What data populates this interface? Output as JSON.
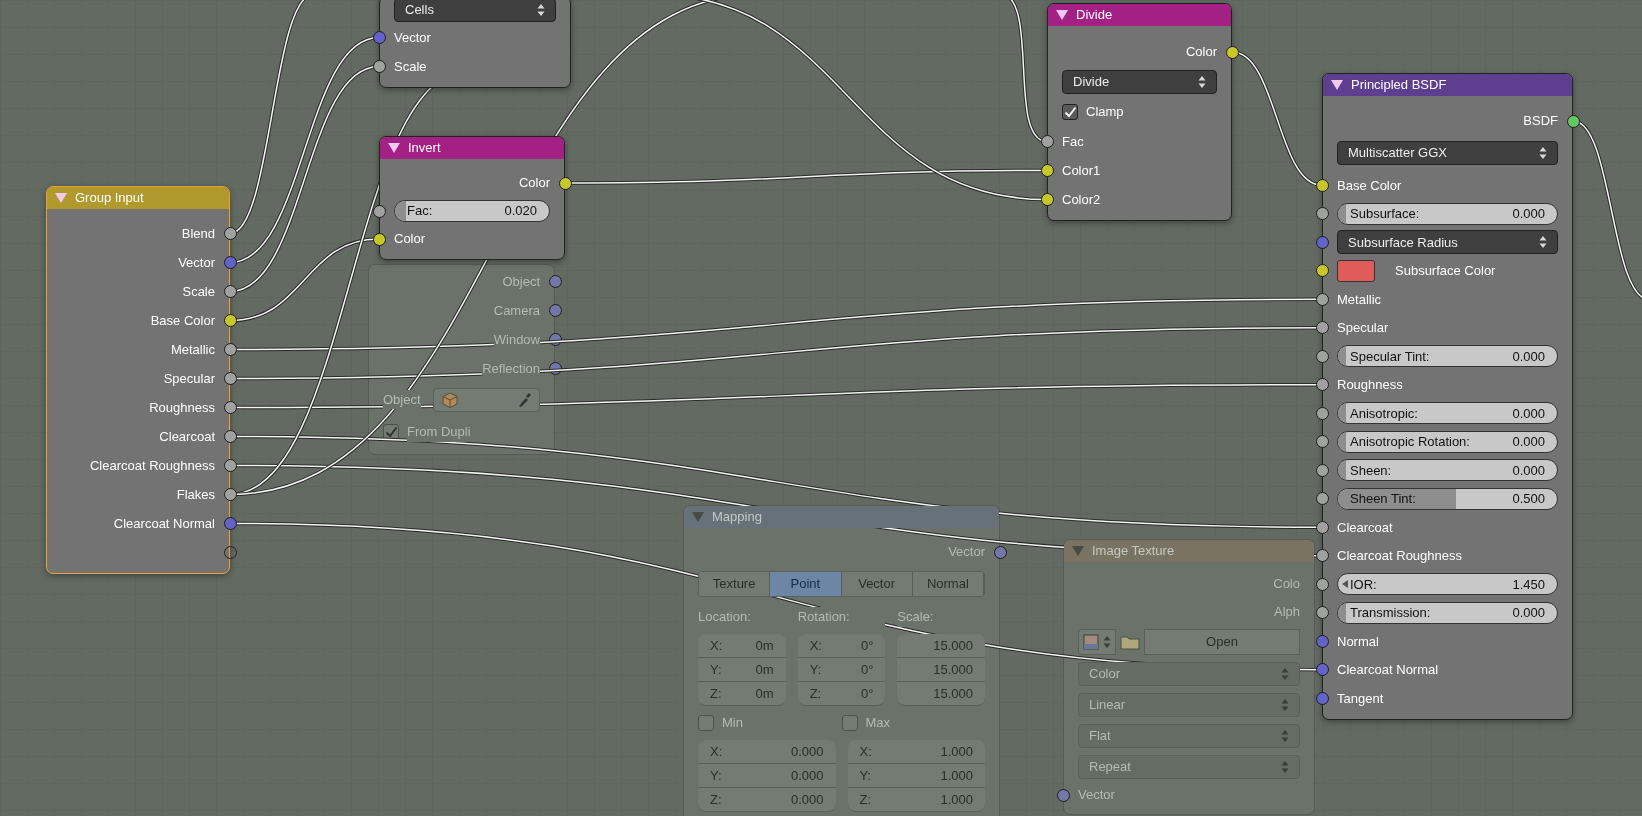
{
  "nodes": [
    {
      "kind": "group_input",
      "faded": false,
      "selected": true,
      "title": "Group Input",
      "color": "#b09a2e",
      "rows": [
        {
          "kind": "output",
          "label": "Blend",
          "color": "#a1a1a1"
        },
        {
          "kind": "output",
          "label": "Vector",
          "color": "#6363c7"
        },
        {
          "kind": "output",
          "label": "Scale",
          "color": "#a1a1a1"
        },
        {
          "kind": "output",
          "label": "Base Color",
          "color": "#c7c729"
        },
        {
          "kind": "output",
          "label": "Metallic",
          "color": "#a1a1a1"
        },
        {
          "kind": "output",
          "label": "Specular",
          "color": "#a1a1a1"
        },
        {
          "kind": "output",
          "label": "Roughness",
          "color": "#a1a1a1"
        },
        {
          "kind": "output",
          "label": "Clearcoat",
          "color": "#a1a1a1"
        },
        {
          "kind": "output",
          "label": "Clearcoat Roughness",
          "color": "#a1a1a1"
        },
        {
          "kind": "output",
          "label": "Flakes",
          "color": "#a1a1a1"
        },
        {
          "kind": "output",
          "label": "Clearcoat Normal",
          "color": "#6363c7"
        },
        {
          "kind": "blank_socket"
        }
      ]
    },
    {
      "kind": "voronoi",
      "faded": false,
      "selected": false,
      "rows": [
        {
          "kind": "dropdown",
          "label": "Cells"
        },
        {
          "kind": "input",
          "label": "Vector",
          "color": "#6363c7"
        },
        {
          "kind": "input",
          "label": "Scale",
          "color": "#a1a1a1"
        }
      ]
    },
    {
      "kind": "invert",
      "faded": false,
      "selected": false,
      "title": "Invert",
      "color": "#a32185",
      "rows": [
        {
          "kind": "output",
          "label": "Color",
          "color": "#c7c729"
        },
        {
          "kind": "slider",
          "label": "Fac:",
          "value": "0.020",
          "level": 0.02,
          "color": "#a1a1a1"
        },
        {
          "kind": "input",
          "label": "Color",
          "color": "#c7c729"
        }
      ]
    },
    {
      "kind": "texture_coordinate",
      "faded": true,
      "selected": false,
      "rows": [
        {
          "kind": "output",
          "label": "Object",
          "color": "#7277a6"
        },
        {
          "kind": "output",
          "label": "Camera",
          "color": "#7277a6"
        },
        {
          "kind": "output",
          "label": "Window",
          "color": "#7277a6"
        },
        {
          "kind": "output",
          "label": "Reflection",
          "color": "#7277a6"
        },
        {
          "kind": "object_field",
          "label": "Object"
        },
        {
          "kind": "checkbox",
          "label": "From Dupli",
          "checked": true
        }
      ]
    },
    {
      "kind": "mapping",
      "faded": true,
      "selected": false,
      "title": "Mapping",
      "color": "#66717a",
      "rows": [
        {
          "kind": "output",
          "label": "Vector",
          "color": "#7277a6"
        },
        {
          "kind": "tabs",
          "items": [
            {
              "label": "Texture",
              "selected": false
            },
            {
              "label": "Point",
              "selected": true
            },
            {
              "label": "Vector",
              "selected": false
            },
            {
              "label": "Normal",
              "selected": false
            }
          ]
        },
        {
          "kind": "headings",
          "labels": [
            "Location:",
            "Rotation:",
            "Scale:"
          ]
        },
        {
          "kind": "vector_fields",
          "columns": [
            [
              {
                "axis": "X:",
                "value": "0m"
              },
              {
                "axis": "Y:",
                "value": "0m"
              },
              {
                "axis": "Z:",
                "value": "0m"
              }
            ],
            [
              {
                "axis": "X:",
                "value": "0°"
              },
              {
                "axis": "Y:",
                "value": "0°"
              },
              {
                "axis": "Z:",
                "value": "0°"
              }
            ],
            [
              {
                "value": "15.000"
              },
              {
                "value": "15.000"
              },
              {
                "value": "15.000"
              }
            ]
          ]
        },
        {
          "kind": "checkbox_pair",
          "items": [
            {
              "label": "Min",
              "checked": false
            },
            {
              "label": "Max",
              "checked": false
            }
          ]
        },
        {
          "kind": "vector_fields",
          "columns": [
            [
              {
                "axis": "X:",
                "value": "0.000"
              },
              {
                "axis": "Y:",
                "value": "0.000"
              },
              {
                "axis": "Z:",
                "value": "0.000"
              }
            ],
            [
              {
                "axis": "X:",
                "value": "1.000"
              },
              {
                "axis": "Y:",
                "value": "1.000"
              },
              {
                "axis": "Z:",
                "value": "1.000"
              }
            ]
          ]
        }
      ]
    },
    {
      "kind": "divide",
      "faded": false,
      "selected": false,
      "title": "Divide",
      "color": "#a32185",
      "rows": [
        {
          "kind": "output",
          "label": "Color",
          "color": "#c7c729"
        },
        {
          "kind": "dropdown",
          "label": "Divide"
        },
        {
          "kind": "checkbox",
          "label": "Clamp",
          "checked": true
        },
        {
          "kind": "input",
          "label": "Fac",
          "color": "#a1a1a1"
        },
        {
          "kind": "input",
          "label": "Color1",
          "color": "#c7c729"
        },
        {
          "kind": "input",
          "label": "Color2",
          "color": "#c7c729"
        }
      ]
    },
    {
      "kind": "image_texture",
      "faded": true,
      "selected": false,
      "title": "Image Texture",
      "color": "#7a7262",
      "rows": [
        {
          "kind": "output",
          "label": "Colo"
        },
        {
          "kind": "output",
          "label": "Alph"
        },
        {
          "kind": "file_field",
          "label": "Open"
        },
        {
          "kind": "dropdown",
          "label": "Color"
        },
        {
          "kind": "dropdown",
          "label": "Linear"
        },
        {
          "kind": "dropdown",
          "label": "Flat"
        },
        {
          "kind": "dropdown",
          "label": "Repeat"
        },
        {
          "kind": "input",
          "label": "Vector",
          "color": "#7277a6"
        }
      ]
    },
    {
      "kind": "principled",
      "faded": false,
      "selected": false,
      "title": "Principled BSDF",
      "color": "#5e3f8f",
      "rows": [
        {
          "kind": "output",
          "label": "BSDF",
          "color": "#63c763"
        },
        {
          "kind": "dropdown",
          "label": "Multiscatter GGX"
        },
        {
          "kind": "input",
          "label": "Base Color",
          "color": "#c7c729"
        },
        {
          "kind": "slider",
          "label": "Subsurface:",
          "value": "0.000",
          "level": 0,
          "color": "#a1a1a1"
        },
        {
          "kind": "dropdown",
          "label": "Subsurface Radius",
          "color": "#6363c7"
        },
        {
          "kind": "swatch",
          "label": "Subsurface Color",
          "color": "#e05c5a"
        },
        {
          "kind": "input",
          "label": "Metallic",
          "color": "#a1a1a1"
        },
        {
          "kind": "input",
          "label": "Specular",
          "color": "#a1a1a1"
        },
        {
          "kind": "slider",
          "label": "Specular Tint:",
          "value": "0.000",
          "level": 0,
          "color": "#a1a1a1"
        },
        {
          "kind": "input",
          "label": "Roughness",
          "color": "#a1a1a1"
        },
        {
          "kind": "slider",
          "label": "Anisotropic:",
          "value": "0.000",
          "level": 0,
          "color": "#a1a1a1"
        },
        {
          "kind": "slider",
          "label": "Anisotropic Rotation:",
          "value": "0.000",
          "level": 0,
          "color": "#a1a1a1"
        },
        {
          "kind": "slider",
          "label": "Sheen:",
          "value": "0.000",
          "level": 0,
          "color": "#a1a1a1"
        },
        {
          "kind": "slider",
          "label": "Sheen Tint:",
          "value": "0.500",
          "level": 0.5,
          "color": "#a1a1a1"
        },
        {
          "kind": "input",
          "label": "Clearcoat",
          "color": "#a1a1a1"
        },
        {
          "kind": "input",
          "label": "Clearcoat Roughness",
          "color": "#a1a1a1"
        },
        {
          "kind": "number",
          "label": "IOR:",
          "value": "1.450",
          "color": "#a1a1a1"
        },
        {
          "kind": "slider",
          "label": "Transmission:",
          "value": "0.000",
          "level": 0,
          "color": "#a1a1a1"
        },
        {
          "kind": "input",
          "label": "Normal",
          "color": "#6363c7"
        },
        {
          "kind": "input",
          "label": "Clearcoat Normal",
          "color": "#6363c7"
        },
        {
          "kind": "input",
          "label": "Tangent",
          "color": "#6363c7"
        }
      ]
    }
  ]
}
